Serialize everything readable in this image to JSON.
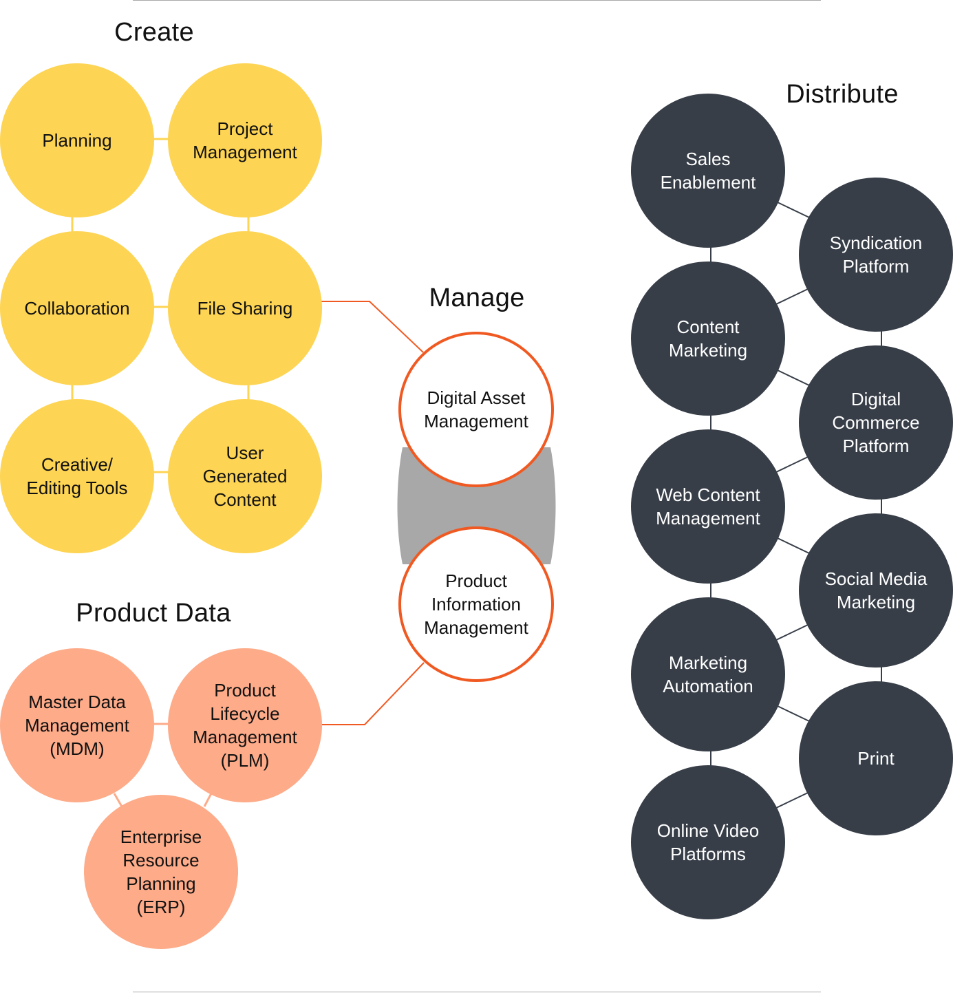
{
  "colors": {
    "create": "#fdd453",
    "product_data": "#fdab89",
    "distribute": "#373e48",
    "manage_stroke": "#f05a22",
    "manage_band": "#a8a8a8"
  },
  "sections": {
    "create": {
      "title": "Create",
      "nodes": [
        "Planning",
        "Project\nManagement",
        "Collaboration",
        "File Sharing",
        "Creative/\nEditing Tools",
        "User\nGenerated\nContent"
      ]
    },
    "product_data": {
      "title": "Product Data",
      "nodes": [
        "Master Data\nManagement\n(MDM)",
        "Product\nLifecycle\nManagement\n(PLM)",
        "Enterprise\nResource\nPlanning\n(ERP)"
      ]
    },
    "manage": {
      "title": "Manage",
      "nodes": [
        "Digital Asset\nManagement",
        "Product\nInformation\nManagement"
      ]
    },
    "distribute": {
      "title": "Distribute",
      "nodes": [
        "Sales\nEnablement",
        "Syndication\nPlatform",
        "Content\nMarketing",
        "Digital\nCommerce\nPlatform",
        "Web Content\nManagement",
        "Social Media\nMarketing",
        "Marketing\nAutomation",
        "Print",
        "Online Video\nPlatforms"
      ]
    }
  }
}
